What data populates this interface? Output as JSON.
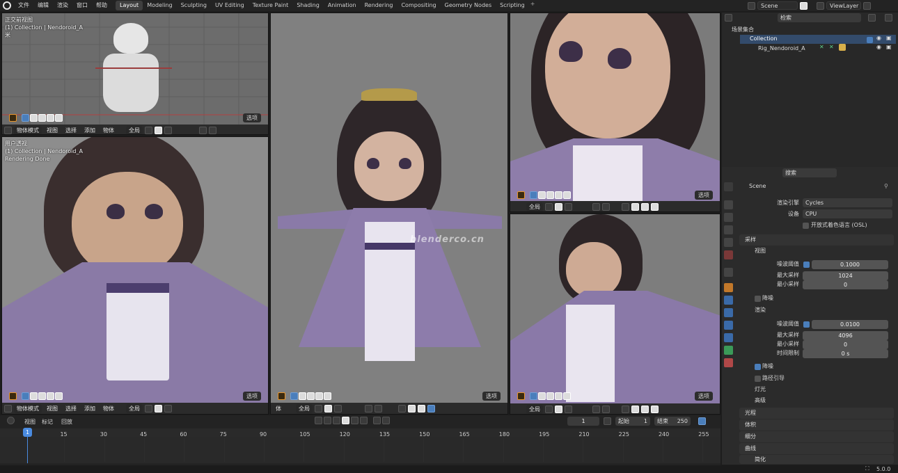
{
  "topbar": {
    "menus": [
      "文件",
      "编辑",
      "渲染",
      "窗口",
      "帮助"
    ],
    "tabs": [
      "Layout",
      "Modeling",
      "Sculpting",
      "UV Editing",
      "Texture Paint",
      "Shading",
      "Animation",
      "Rendering",
      "Compositing",
      "Geometry Nodes",
      "Scripting"
    ],
    "active_tab": "Layout",
    "scene": "Scene",
    "view_layer": "ViewLayer"
  },
  "viewport_tl": {
    "line1": "正交前视图",
    "line2": "(1) Collection | Nendoroid_A",
    "line3": "米",
    "select": "选项",
    "mode": "物体模式",
    "menus": [
      "视图",
      "选择",
      "添加",
      "物体"
    ],
    "transform": "全局"
  },
  "viewport_bl": {
    "line1": "用户透视",
    "line2": "(1) Collection | Nendoroid_A",
    "line3": "Rendering Done",
    "select": "选项",
    "mode": "物体模式",
    "menus": [
      "视图",
      "选择",
      "添加",
      "物体"
    ],
    "transform": "全局"
  },
  "viewport_center": {
    "select": "选项",
    "partial": "体",
    "transform": "全局",
    "watermark": "blenderco.cn"
  },
  "viewport_tr": {
    "select": "选项",
    "transform": "全局"
  },
  "viewport_br": {
    "select": "选项",
    "transform": "全局"
  },
  "outliner": {
    "search_placeholder": "检索",
    "root": "场景集合",
    "collection": "Collection",
    "object": "Rig_Nendoroid_A"
  },
  "properties": {
    "search_placeholder": "搜索",
    "scene": "Scene",
    "render_engine_label": "渲染引擎",
    "render_engine": "Cycles",
    "device_label": "设备",
    "device": "CPU",
    "osl_label": "开放式着色语言 (OSL)",
    "sampling": "采样",
    "viewport": "视图",
    "vp_noise_label": "噪波阈值",
    "vp_noise": "0.1000",
    "vp_max_label": "最大采样",
    "vp_max": "1024",
    "vp_min_label": "最小采样",
    "vp_min": "0",
    "vp_denoise": "降噪",
    "render": "渲染",
    "r_noise_label": "噪波阈值",
    "r_noise": "0.0100",
    "r_max_label": "最大采样",
    "r_max": "4096",
    "r_min_label": "最小采样",
    "r_min": "0",
    "r_time_label": "时间限制",
    "r_time": "0 s",
    "r_denoise": "降噪",
    "path_guiding": "路径引导",
    "lights": "灯光",
    "advanced": "高级",
    "light_paths": "光程",
    "volumes": "体积",
    "subdivision": "细分",
    "curves": "曲线",
    "simplify": "简化"
  },
  "timeline": {
    "menus": [
      "视图",
      "标记",
      "回放"
    ],
    "current_frame": "1",
    "start_label": "起始",
    "start": "1",
    "end_label": "结束",
    "end": "250",
    "ticks": [
      "15",
      "30",
      "45",
      "60",
      "75",
      "90",
      "105",
      "120",
      "135",
      "150",
      "165",
      "180",
      "195",
      "210",
      "225",
      "240",
      "255"
    ],
    "playhead": "1"
  },
  "status": {
    "version": "5.0.0"
  }
}
